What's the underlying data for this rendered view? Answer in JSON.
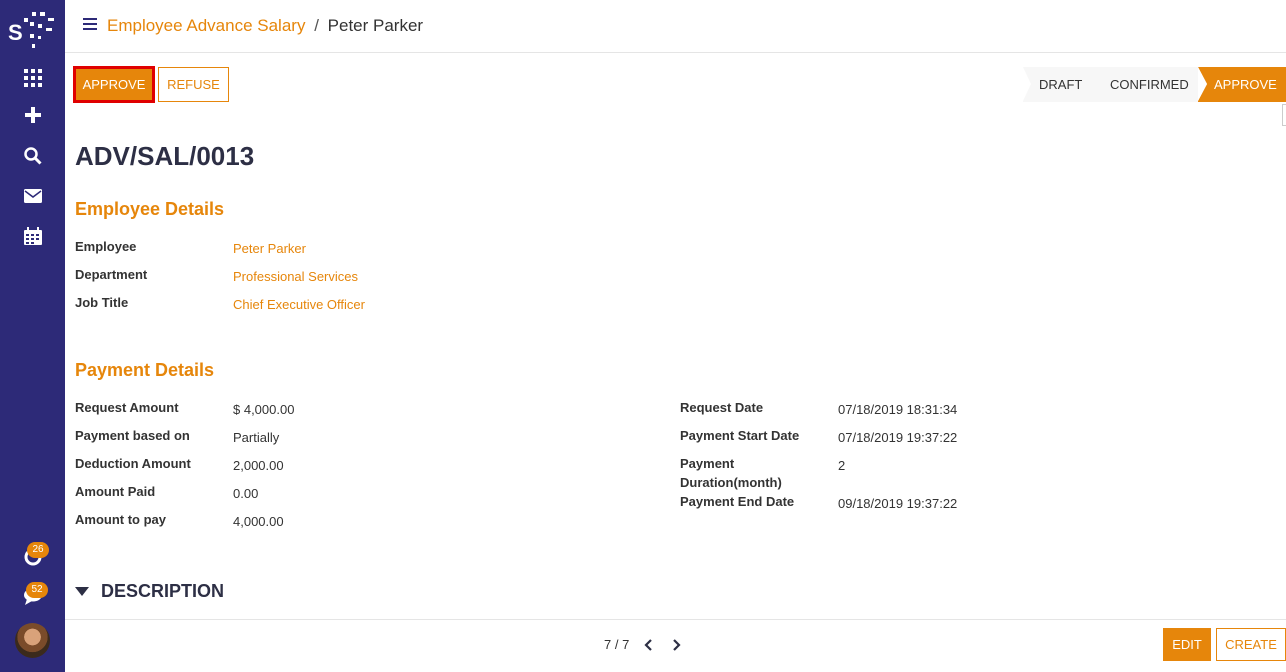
{
  "sidebar": {
    "logo_icon": "app-logo",
    "items": [
      {
        "icon": "apps-grid-icon"
      },
      {
        "icon": "plus-icon"
      },
      {
        "icon": "search-icon"
      },
      {
        "icon": "envelope-icon"
      },
      {
        "icon": "calendar-icon"
      }
    ],
    "activity_count": "26",
    "messages_count": "52"
  },
  "breadcrumb": {
    "parent": "Employee Advance Salary",
    "separator": "/",
    "current": "Peter Parker"
  },
  "toolbar": {
    "approve_label": "APPROVE",
    "refuse_label": "REFUSE"
  },
  "statusbar": {
    "stages": [
      "DRAFT",
      "CONFIRMED",
      "APPROVE"
    ],
    "active": "APPROVE"
  },
  "record": {
    "title": "ADV/SAL/0013",
    "employee_section": "Employee Details",
    "employee_fields": [
      {
        "label": "Employee",
        "value": "Peter Parker"
      },
      {
        "label": "Department",
        "value": "Professional Services"
      },
      {
        "label": "Job Title",
        "value": "Chief Executive Officer"
      }
    ],
    "payment_section": "Payment Details",
    "payment_left": [
      {
        "label": "Request Amount",
        "value": "$ 4,000.00"
      },
      {
        "label": "Payment based on",
        "value": "Partially"
      },
      {
        "label": "Deduction Amount",
        "value": "2,000.00"
      },
      {
        "label": "Amount Paid",
        "value": "0.00"
      },
      {
        "label": "Amount to pay",
        "value": "4,000.00"
      }
    ],
    "payment_right": [
      {
        "label": "Request Date",
        "value": "07/18/2019 18:31:34"
      },
      {
        "label": "Payment Start Date",
        "value": "07/18/2019 19:37:22"
      },
      {
        "label_line1": "Payment",
        "label_line2": "Duration(month)",
        "value": "2"
      },
      {
        "label": "Payment End Date",
        "value": "09/18/2019 19:37:22"
      }
    ],
    "description_label": "DESCRIPTION"
  },
  "footer": {
    "pager": "7 / 7",
    "edit_label": "EDIT",
    "create_label": "CREATE"
  },
  "colors": {
    "sidebar": "#2d2a78",
    "accent": "#e6860b",
    "highlight_border": "#e00000"
  }
}
